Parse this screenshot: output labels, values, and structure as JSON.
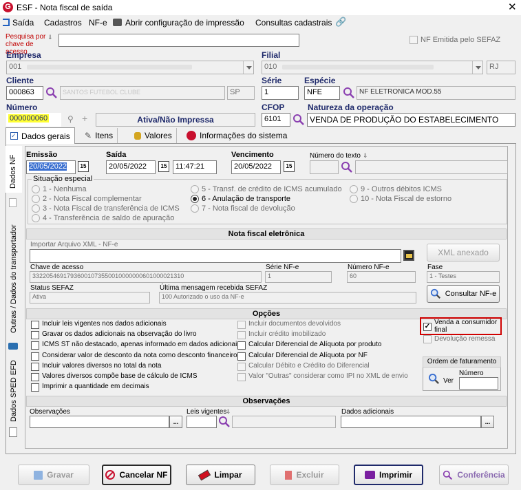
{
  "window": {
    "title": "ESF - Nota fiscal de saída"
  },
  "menu": [
    "Saída",
    "Cadastros",
    "NF-e",
    "Abrir configuração de impressão",
    "Consultas cadastrais"
  ],
  "search": {
    "label": "Pesquisa por chave de acesso",
    "value": ""
  },
  "nf_emitida": "NF Emitida pelo SEFAZ",
  "empresa": {
    "label": "Empresa",
    "code": "001"
  },
  "filial": {
    "label": "Filial",
    "code": "010",
    "uf": "RJ"
  },
  "cliente": {
    "label": "Cliente",
    "code": "000863",
    "name": "SANTOS FUTEBOL CLUBE",
    "uf": "SP"
  },
  "serie": {
    "label": "Série",
    "value": "1"
  },
  "especie": {
    "label": "Espécie",
    "code": "NFE",
    "desc": "NF ELETRONICA MOD.55"
  },
  "numero": {
    "label": "Número",
    "value": "000000060",
    "status": "Ativa/Não Impressa"
  },
  "cfop": {
    "label": "CFOP",
    "value": "6101"
  },
  "natureza": {
    "label": "Natureza da operação",
    "value": "VENDA DE PRODUÇÃO DO ESTABELECIMENTO"
  },
  "tabs": [
    "Dados gerais",
    "Itens",
    "Valores",
    "Informações do sistema"
  ],
  "side_tabs": [
    "Dados NF",
    "Outras / Dados do transportador",
    "Dados SPED EFD"
  ],
  "emissao": {
    "label": "Emissão",
    "value": "20/05/2022"
  },
  "saida": {
    "label": "Saída",
    "date": "20/05/2022",
    "time": "11:47:21"
  },
  "vencimento": {
    "label": "Vencimento",
    "value": "20/05/2022"
  },
  "numero_texto": {
    "label": "Número do texto"
  },
  "situacao": {
    "label": "Situação especial",
    "options": [
      "1 - Nenhuma",
      "2 - Nota Fiscal complementar",
      "3 - Nota Fiscal de transferência de ICMS",
      "4 - Transferência de saldo de apuração",
      "5 - Transf. de crédito de ICMS acumulado",
      "6 - Anulação de transporte",
      "7 - Nota fiscal de devolução",
      "9 - Outros débitos ICMS",
      "10 - Nota Fiscal de estorno"
    ]
  },
  "nfe": {
    "title": "Nota fiscal eletrônica",
    "import_label": "Importar Arquivo XML - NF-e",
    "xml_btn": "XML anexado",
    "chave_label": "Chave de acesso",
    "chave": "33220546917936001073550010000000601000021310",
    "serie_label": "Série NF-e",
    "serie": "1",
    "numero_label": "Número NF-e",
    "numero": "60",
    "fase_label": "Fase",
    "fase": "1 - Testes",
    "status_label": "Status SEFAZ",
    "status": "Ativa",
    "msg_label": "Última mensagem recebida SEFAZ",
    "msg": "100 Autorizado o uso da NF-e",
    "consultar": "Consultar NF-e"
  },
  "opcoes": {
    "title": "Opções",
    "left": [
      "Incluir leis vigentes nos dados adicionais",
      "Gravar os dados adicionais na observação do livro",
      "ICMS ST não destacado, apenas informado em dados adicionais",
      "Considerar valor de desconto da nota como desconto financeiro",
      "Incluir valores diversos no total da nota",
      "Valores diversos compõe base de cálculo de ICMS",
      "Imprimir a quantidade em decimais"
    ],
    "mid": [
      "Incluir documentos devolvidos",
      "Incluir crédito imobilizado",
      "Calcular Diferencial de Alíquota por produto",
      "Calcular Diferencial de Alíquota por NF",
      "Calcular Débito e Crédito do Diferencial",
      "Valor \"Outras\" considerar como IPI no XML de envio"
    ],
    "venda": "Venda a consumidor final",
    "devolucao": "Devolução remessa",
    "ordem": "Ordem de faturamento",
    "ver": "Ver",
    "numero": "Número"
  },
  "obs": {
    "title": "Observações",
    "obs_label": "Observações",
    "leis_label": "Leis vigentes",
    "dados_label": "Dados adicionais"
  },
  "buttons": {
    "gravar": "Gravar",
    "cancelar": "Cancelar NF",
    "limpar": "Limpar",
    "excluir": "Excluir",
    "imprimir": "Imprimir",
    "conferencia": "Conferência"
  }
}
